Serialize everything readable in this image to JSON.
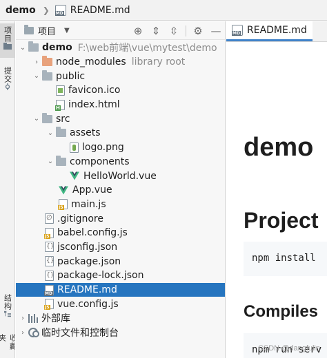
{
  "breadcrumb": {
    "project": "demo",
    "file": "README.md"
  },
  "tool_strip": {
    "project_label": "项目",
    "commit_label": "提交",
    "structure_label": "结构",
    "favorites_label": "收藏夹"
  },
  "project_panel": {
    "title": "项目",
    "header_icons": [
      "crosshair-icon",
      "expand-all-icon",
      "collapse-all-icon",
      "gear-icon",
      "minimize-icon"
    ]
  },
  "tree": {
    "root": {
      "name": "demo",
      "path": "F:\\web前端\\vue\\mytest\\demo"
    },
    "node_modules": {
      "name": "node_modules",
      "hint": "library root"
    },
    "public": "public",
    "favicon": "favicon.ico",
    "index_html": "index.html",
    "src": "src",
    "assets": "assets",
    "logo": "logo.png",
    "components": "components",
    "helloworld": "HelloWorld.vue",
    "app_vue": "App.vue",
    "main_js": "main.js",
    "gitignore": ".gitignore",
    "babel": "babel.config.js",
    "jsconfig": "jsconfig.json",
    "package": "package.json",
    "package_lock": "package-lock.json",
    "readme": "README.md",
    "vue_config": "vue.config.js",
    "external_libs": "外部库",
    "scratches": "临时文件和控制台"
  },
  "editor": {
    "tab_label": "README.md",
    "h1": "demo",
    "h2": "Project",
    "code1": "npm install",
    "h3": "Compiles",
    "code2": "npm run serv"
  },
  "watermark": "CSDN @dangfulin",
  "colors": {
    "selection": "#2675bf",
    "vue_green": "#41b883",
    "vue_dark": "#35495e",
    "tab_underline": "#4083c9"
  }
}
